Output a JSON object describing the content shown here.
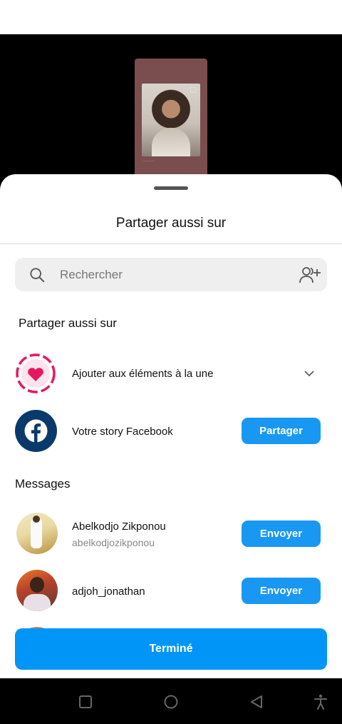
{
  "sheet": {
    "title": "Partager aussi sur"
  },
  "search": {
    "placeholder": "Rechercher"
  },
  "share_section": {
    "label": "Partager aussi sur",
    "highlights": {
      "label": "Ajouter aux éléments à la une"
    },
    "facebook": {
      "label": "Votre story Facebook",
      "button": "Partager"
    }
  },
  "messages": {
    "label": "Messages",
    "contacts": [
      {
        "name": "Abelkodjo Zikponou",
        "username": "abelkodjozikponou",
        "button": "Envoyer"
      },
      {
        "name": "adjoh_jonathan",
        "button": "Envoyer"
      }
    ]
  },
  "footer": {
    "done_label": "Terminé"
  },
  "colors": {
    "accent": "#0095f6",
    "highlight_pink": "#e8175d",
    "facebook_blue": "#0a3a6c"
  }
}
